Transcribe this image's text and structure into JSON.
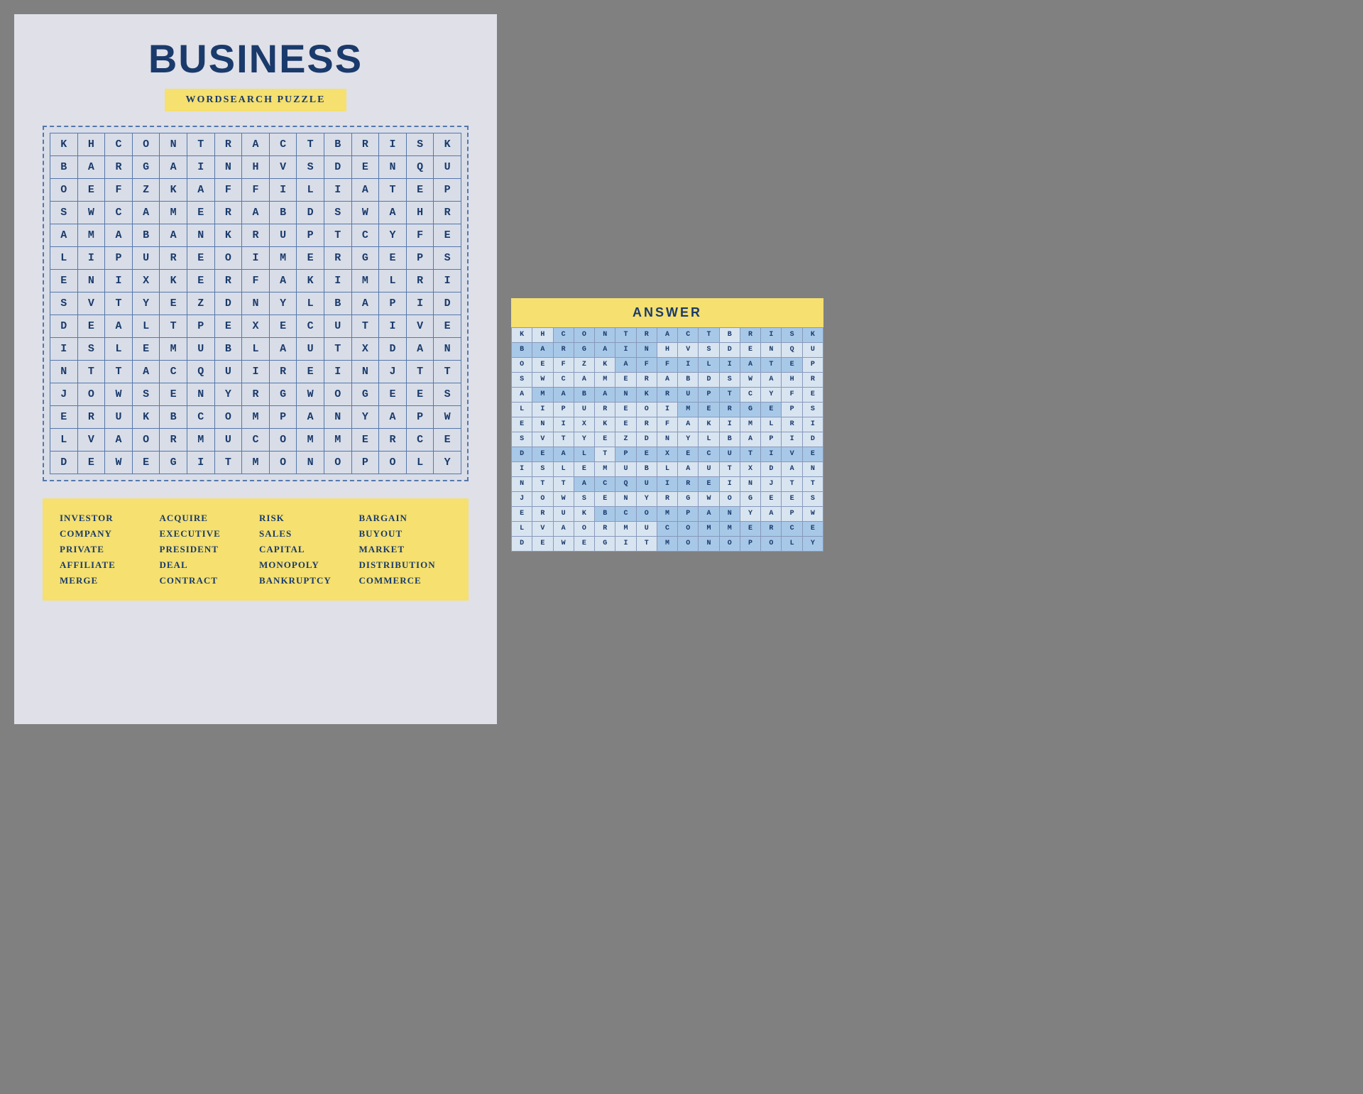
{
  "title": "BUSINESS",
  "subtitle": "WORDSEARCH PUZZLE",
  "answer_label": "ANSWER",
  "grid_rows": [
    [
      "K",
      "H",
      "C",
      "O",
      "N",
      "T",
      "R",
      "A",
      "C",
      "T",
      "B",
      "R",
      "I",
      "S",
      "K"
    ],
    [
      "B",
      "A",
      "R",
      "G",
      "A",
      "I",
      "N",
      "H",
      "V",
      "S",
      "D",
      "E",
      "N",
      "Q",
      "U"
    ],
    [
      "O",
      "E",
      "F",
      "Z",
      "K",
      "A",
      "F",
      "F",
      "I",
      "L",
      "I",
      "A",
      "T",
      "E",
      "P"
    ],
    [
      "S",
      "W",
      "C",
      "A",
      "M",
      "E",
      "R",
      "A",
      "B",
      "D",
      "S",
      "W",
      "A",
      "H",
      "R"
    ],
    [
      "A",
      "M",
      "A",
      "B",
      "A",
      "N",
      "K",
      "R",
      "U",
      "P",
      "T",
      "C",
      "Y",
      "F",
      "E"
    ],
    [
      "L",
      "I",
      "P",
      "U",
      "R",
      "E",
      "O",
      "I",
      "M",
      "E",
      "R",
      "G",
      "E",
      "P",
      "S"
    ],
    [
      "E",
      "N",
      "I",
      "X",
      "K",
      "E",
      "R",
      "F",
      "A",
      "K",
      "I",
      "M",
      "L",
      "R",
      "I"
    ],
    [
      "S",
      "V",
      "T",
      "Y",
      "E",
      "Z",
      "D",
      "N",
      "Y",
      "L",
      "B",
      "A",
      "P",
      "I",
      "D"
    ],
    [
      "D",
      "E",
      "A",
      "L",
      "T",
      "P",
      "E",
      "X",
      "E",
      "C",
      "U",
      "T",
      "I",
      "V",
      "E"
    ],
    [
      "I",
      "S",
      "L",
      "E",
      "M",
      "U",
      "B",
      "L",
      "A",
      "U",
      "T",
      "X",
      "D",
      "A",
      "N"
    ],
    [
      "N",
      "T",
      "T",
      "A",
      "C",
      "Q",
      "U",
      "I",
      "R",
      "E",
      "I",
      "N",
      "J",
      "T",
      "T"
    ],
    [
      "J",
      "O",
      "W",
      "S",
      "E",
      "N",
      "Y",
      "R",
      "G",
      "W",
      "O",
      "G",
      "E",
      "E",
      "S"
    ],
    [
      "E",
      "R",
      "U",
      "K",
      "B",
      "C",
      "O",
      "M",
      "P",
      "A",
      "N",
      "Y",
      "A",
      "P",
      "W"
    ],
    [
      "L",
      "V",
      "A",
      "O",
      "R",
      "M",
      "U",
      "C",
      "O",
      "M",
      "M",
      "E",
      "R",
      "C",
      "E"
    ],
    [
      "D",
      "E",
      "W",
      "E",
      "G",
      "I",
      "T",
      "M",
      "O",
      "N",
      "O",
      "P",
      "O",
      "L",
      "Y"
    ]
  ],
  "highlighted": {
    "CONTRACT": [
      [
        0,
        2
      ],
      [
        0,
        3
      ],
      [
        0,
        4
      ],
      [
        0,
        5
      ],
      [
        0,
        6
      ],
      [
        0,
        7
      ],
      [
        0,
        8
      ],
      [
        0,
        9
      ]
    ],
    "RISK": [
      [
        0,
        11
      ],
      [
        0,
        12
      ],
      [
        0,
        13
      ],
      [
        0,
        14
      ]
    ],
    "BARGAIN": [
      [
        1,
        0
      ],
      [
        1,
        1
      ],
      [
        1,
        2
      ],
      [
        1,
        3
      ],
      [
        1,
        4
      ],
      [
        1,
        5
      ],
      [
        1,
        6
      ]
    ],
    "AFFILIATE": [
      [
        2,
        6
      ],
      [
        2,
        7
      ],
      [
        2,
        8
      ],
      [
        2,
        9
      ],
      [
        2,
        10
      ],
      [
        2,
        11
      ],
      [
        2,
        12
      ],
      [
        2,
        13
      ]
    ],
    "BANKRUPTCY": [
      [
        4,
        1
      ],
      [
        4,
        2
      ],
      [
        4,
        3
      ],
      [
        4,
        4
      ],
      [
        4,
        5
      ],
      [
        4,
        6
      ],
      [
        4,
        7
      ],
      [
        4,
        8
      ],
      [
        4,
        9
      ],
      [
        4,
        10
      ]
    ],
    "MERGE": [
      [
        5,
        8
      ],
      [
        5,
        9
      ],
      [
        5,
        10
      ],
      [
        5,
        11
      ],
      [
        5,
        12
      ]
    ],
    "DEAL": [
      [
        8,
        0
      ],
      [
        8,
        1
      ],
      [
        8,
        2
      ],
      [
        8,
        3
      ]
    ],
    "EXECUTIVE": [
      [
        8,
        6
      ],
      [
        8,
        7
      ],
      [
        8,
        8
      ],
      [
        8,
        9
      ],
      [
        8,
        10
      ],
      [
        8,
        11
      ],
      [
        8,
        12
      ],
      [
        8,
        13
      ],
      [
        8,
        14
      ]
    ],
    "ACQUIRE": [
      [
        10,
        3
      ],
      [
        10,
        4
      ],
      [
        10,
        5
      ],
      [
        10,
        6
      ],
      [
        10,
        7
      ],
      [
        10,
        8
      ],
      [
        10,
        9
      ]
    ],
    "COMPANY": [
      [
        12,
        4
      ],
      [
        12,
        5
      ],
      [
        12,
        6
      ],
      [
        12,
        7
      ],
      [
        12,
        8
      ],
      [
        12,
        9
      ],
      [
        12,
        10
      ]
    ],
    "COMMERCE": [
      [
        13,
        7
      ],
      [
        13,
        8
      ],
      [
        13,
        9
      ],
      [
        13,
        10
      ],
      [
        13,
        11
      ],
      [
        13,
        12
      ],
      [
        13,
        13
      ],
      [
        13,
        14
      ]
    ],
    "MONOPOLY": [
      [
        14,
        7
      ],
      [
        14,
        8
      ],
      [
        14,
        9
      ],
      [
        14,
        10
      ],
      [
        14,
        11
      ],
      [
        14,
        12
      ],
      [
        14,
        13
      ],
      [
        14,
        14
      ]
    ],
    "CAPITAL": [
      [
        5,
        0
      ]
    ],
    "SALES": [
      [
        6,
        0
      ]
    ],
    "INVESTOR": [],
    "PRIVATE": [],
    "MARKET": [],
    "DISTRIBUTION": [],
    "PRESIDENT": [],
    "BUYOUT": []
  },
  "words": [
    [
      "INVESTOR",
      "ACQUIRE",
      "RISK",
      "BARGAIN"
    ],
    [
      "COMPANY",
      "EXECUTIVE",
      "SALES",
      "BUYOUT"
    ],
    [
      "PRIVATE",
      "PRESIDENT",
      "CAPITAL",
      "MARKET"
    ],
    [
      "AFFILIATE",
      "DEAL",
      "MONOPOLY",
      "DISTRIBUTION"
    ],
    [
      "MERGE",
      "CONTRACT",
      "BANKRUPTCY",
      "COMMERCE"
    ]
  ],
  "answer_highlighted_map": {
    "0": [
      2,
      3,
      4,
      5,
      6,
      7,
      8,
      9,
      11,
      12,
      13,
      14
    ],
    "1": [
      0,
      1,
      2,
      3,
      4,
      5,
      6
    ],
    "2": [
      5,
      6,
      7,
      8,
      9,
      10,
      11,
      12,
      13
    ],
    "4": [
      1,
      2,
      3,
      4,
      5,
      6,
      7,
      8,
      9,
      10
    ],
    "5": [
      8,
      9,
      10,
      11,
      12
    ],
    "8": [
      0,
      1,
      2,
      3,
      5,
      6,
      7,
      8,
      9,
      10,
      11,
      12,
      13,
      14
    ],
    "10": [
      3,
      4,
      5,
      6,
      7,
      8,
      9
    ],
    "12": [
      4,
      5,
      6,
      7,
      8,
      9,
      10
    ],
    "13": [
      7,
      8,
      9,
      10,
      11,
      12,
      13,
      14
    ],
    "14": [
      7,
      8,
      9,
      10,
      11,
      12,
      13,
      14
    ]
  }
}
